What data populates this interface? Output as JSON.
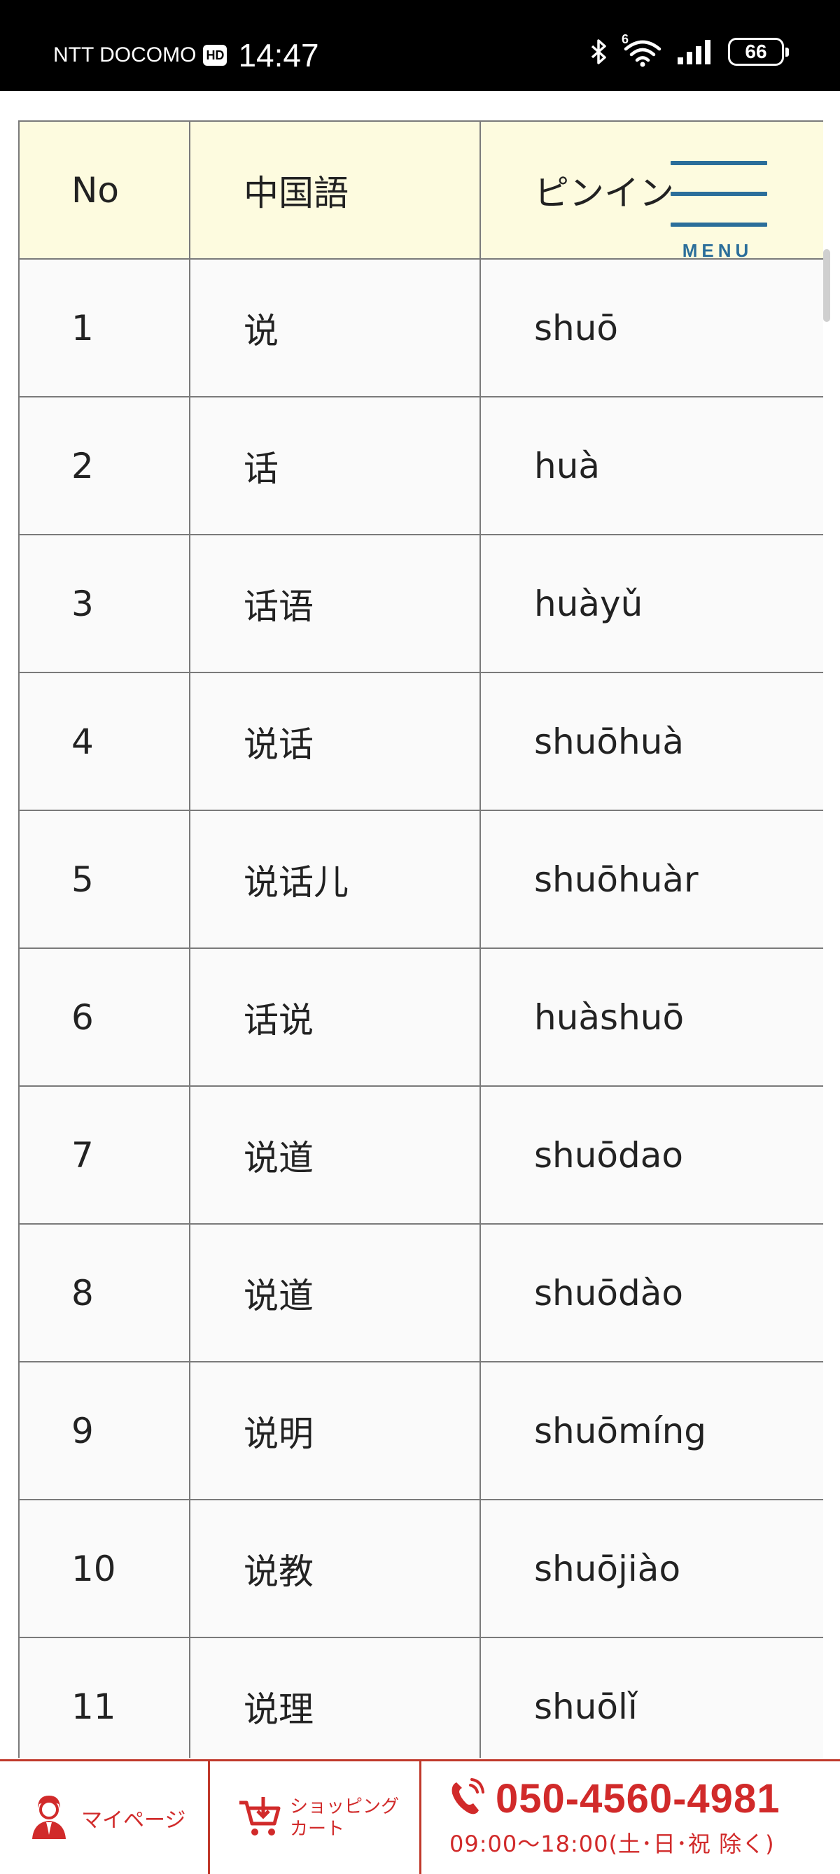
{
  "status_bar": {
    "carrier": "NTT DOCOMO",
    "hd_badge": "HD",
    "time": "14:47",
    "wifi_badge": "6",
    "battery": "66"
  },
  "menu": {
    "label": "MENU"
  },
  "table": {
    "headers": [
      "No",
      "中国語",
      "ピンイン"
    ],
    "rows": [
      [
        "1",
        "说",
        "shuō"
      ],
      [
        "2",
        "话",
        "huà"
      ],
      [
        "3",
        "话语",
        "huàyǔ"
      ],
      [
        "4",
        "说话",
        "shuōhuà"
      ],
      [
        "5",
        "说话儿",
        "shuōhuàr"
      ],
      [
        "6",
        "话说",
        "huàshuō"
      ],
      [
        "7",
        "说道",
        "shuōdao"
      ],
      [
        "8",
        "说道",
        "shuōdào"
      ],
      [
        "9",
        "说明",
        "shuōmíng"
      ],
      [
        "10",
        "说教",
        "shuōjiào"
      ],
      [
        "11",
        "说理",
        "shuōlǐ"
      ]
    ]
  },
  "bottom_bar": {
    "mypage_label": "マイページ",
    "cart_label_line1": "ショッピング",
    "cart_label_line2": "カート",
    "phone_number": "050-4560-4981",
    "phone_hours": "09:00〜18:00(土･日･祝 除く)"
  },
  "colors": {
    "accent_red": "#d12a2a",
    "menu_blue": "#2b6e9a",
    "header_bg": "#fdfbdf"
  }
}
